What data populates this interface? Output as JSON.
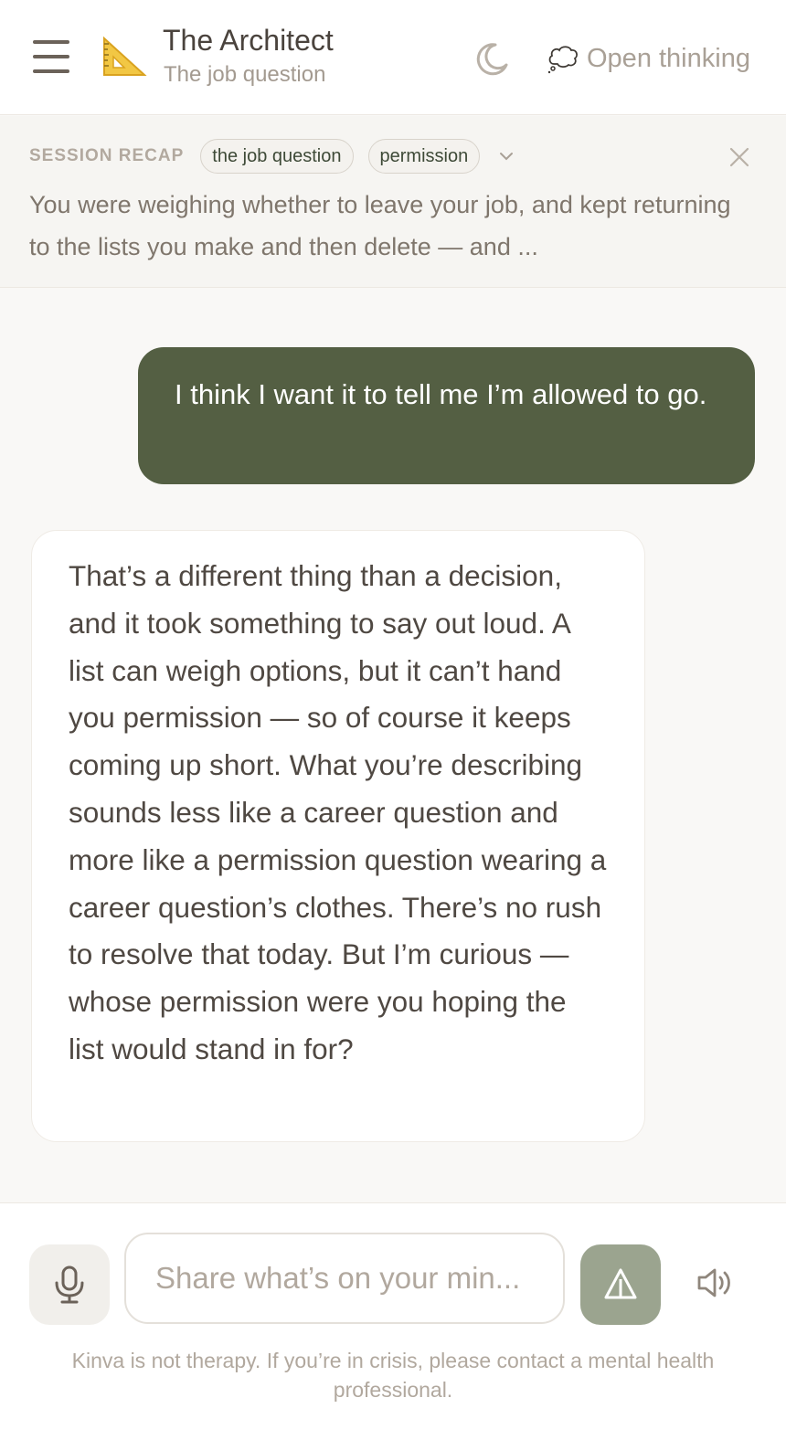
{
  "header": {
    "title": "The Architect",
    "subtitle": "The job question",
    "open_thinking_label": "Open thinking",
    "icons": [
      "menu-icon",
      "triangular-ruler-icon",
      "moon-icon",
      "thought-bubble-icon"
    ]
  },
  "recap": {
    "label": "SESSION RECAP",
    "tags": [
      "the job question",
      "permission"
    ],
    "text": "You were weighing whether to leave your job, and kept returning to the lists you make and then delete — and ..."
  },
  "messages": [
    {
      "role": "user",
      "text": "I think I want it to tell me I’m allowed to go."
    },
    {
      "role": "assistant",
      "text": "That’s a different thing than a decision, and it took something to say out loud. A list can weigh options, but it can’t hand you permission — so of course it keeps coming up short. What you’re describing sounds less like a career question and more like a permission question wearing a career question’s clothes. There’s no rush to resolve that today. But I’m curious — whose permission were you hoping the list would stand in for?"
    }
  ],
  "composer": {
    "placeholder": "Share what’s on your min...",
    "disclaimer": "Kinva is not therapy. If you’re in crisis, please contact a mental health professional."
  },
  "colors": {
    "user_bubble": "#545f43",
    "send_button": "#9ba48f",
    "background": "#f9f8f6"
  }
}
